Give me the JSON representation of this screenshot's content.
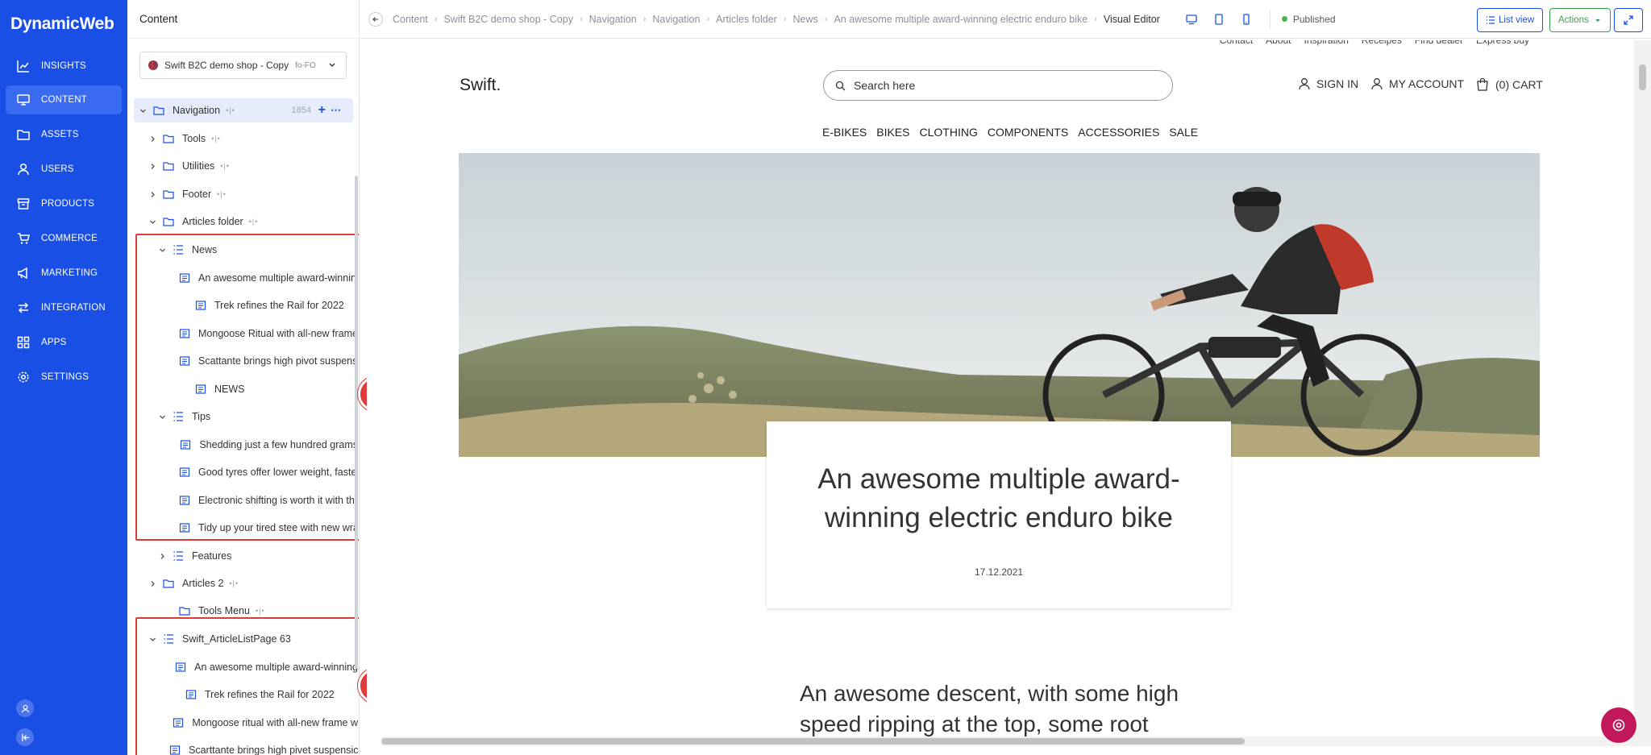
{
  "brand": "DynamicWeb",
  "nav": [
    {
      "label": "INSIGHTS",
      "icon": "chart-line-icon"
    },
    {
      "label": "CONTENT",
      "icon": "monitor-icon"
    },
    {
      "label": "ASSETS",
      "icon": "folder-icon"
    },
    {
      "label": "USERS",
      "icon": "user-icon"
    },
    {
      "label": "PRODUCTS",
      "icon": "box-icon"
    },
    {
      "label": "COMMERCE",
      "icon": "cart-icon"
    },
    {
      "label": "MARKETING",
      "icon": "megaphone-icon"
    },
    {
      "label": "INTEGRATION",
      "icon": "arrows-icon"
    },
    {
      "label": "APPS",
      "icon": "grid-icon"
    },
    {
      "label": "SETTINGS",
      "icon": "gear-icon"
    }
  ],
  "tree": {
    "header": "Content",
    "site_name": "Swift B2C demo shop - Copy",
    "site_lang": "fo-FO",
    "rows": [
      {
        "label": "Navigation",
        "count": "1854"
      },
      {
        "label": "Tools"
      },
      {
        "label": "Utilities"
      },
      {
        "label": "Footer"
      },
      {
        "label": "Articles folder"
      },
      {
        "label": "News"
      },
      {
        "label": "An awesome multiple award-winning electric enduro bike"
      },
      {
        "label": "Trek refines the Rail for 2022"
      },
      {
        "label": "Mongoose Ritual with all-new frame"
      },
      {
        "label": "Scattante brings high pivot suspension"
      },
      {
        "label": "NEWS"
      },
      {
        "label": "Tips"
      },
      {
        "label": "Shedding just a few hundred grams"
      },
      {
        "label": "Good tyres offer lower weight, faster"
      },
      {
        "label": "Electronic shifting is worth it with the"
      },
      {
        "label": "Tidy up your tired stee with new wraps"
      },
      {
        "label": "Features"
      },
      {
        "label": "Articles 2"
      },
      {
        "label": "Tools Menu"
      },
      {
        "label": "Swift_ArticleListPage 63"
      },
      {
        "label": "An awesome multiple award-winning"
      },
      {
        "label": "Trek refines the Rail for 2022"
      },
      {
        "label": "Mongoose ritual with all-new frame w"
      },
      {
        "label": "Scarttante brings high pivet suspensic"
      }
    ],
    "dots": "•|•",
    "annotations": [
      "1",
      "2"
    ]
  },
  "breadcrumbs": [
    "Content",
    "Swift B2C demo shop - Copy",
    "Navigation",
    "Navigation",
    "Articles folder",
    "News",
    "An awesome multiple award-winning electric enduro bike",
    "Visual Editor"
  ],
  "status": "Published",
  "buttons": {
    "list_view": "List view",
    "actions": "Actions"
  },
  "preview": {
    "util_links": [
      "Contact",
      "About",
      "Inspiration",
      "Receipes",
      "Find dealer",
      "Express buy"
    ],
    "logo": "Swift.",
    "search_placeholder": "Search here",
    "sign_in": "SIGN IN",
    "my_account": "MY ACCOUNT",
    "cart": "(0) CART",
    "menu": [
      "E-BIKES",
      "BIKES",
      "CLOTHING",
      "COMPONENTS",
      "ACCESSORIES",
      "SALE"
    ],
    "article_title": "An awesome multiple award-winning electric enduro bike",
    "article_date": "17.12.2021",
    "body_text": "An awesome descent, with some high speed ripping at the top, some root"
  },
  "colors": {
    "brand": "#1a4fe6",
    "annotation": "#e03b3b",
    "published": "#4caf50",
    "actions": "#3aa04a"
  }
}
